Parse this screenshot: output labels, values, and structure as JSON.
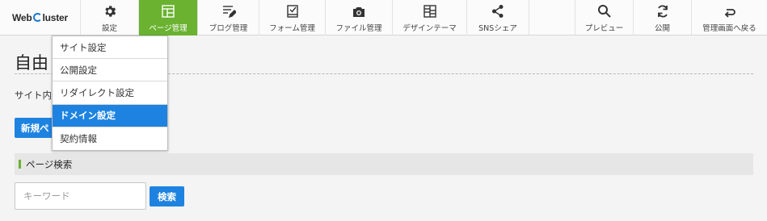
{
  "logo": {
    "text_before": "Web",
    "text_after": "luster"
  },
  "toolbar": {
    "items": [
      {
        "label": "設定",
        "icon": "gear-icon"
      },
      {
        "label": "ページ管理",
        "icon": "page-layout-icon"
      },
      {
        "label": "ブログ管理",
        "icon": "blog-edit-icon"
      },
      {
        "label": "フォーム管理",
        "icon": "form-check-icon"
      },
      {
        "label": "ファイル管理",
        "icon": "camera-icon"
      },
      {
        "label": "デザインテーマ",
        "icon": "design-layout-icon"
      },
      {
        "label": "SNSシェア",
        "icon": "share-icon"
      },
      {
        "label": "プレビュー",
        "icon": "search-icon"
      },
      {
        "label": "公開",
        "icon": "refresh-icon"
      },
      {
        "label": "管理画面へ戻る",
        "icon": "return-arrow-icon"
      }
    ],
    "active_label": "ページ管理"
  },
  "colors": {
    "accent_green": "#6ab230",
    "primary_blue": "#1e83e0"
  },
  "dropdown": {
    "items": [
      "サイト設定",
      "公開設定",
      "リダイレクト設定",
      "ドメイン設定",
      "契約情報"
    ],
    "selected": "ドメイン設定"
  },
  "main": {
    "title": "自由",
    "intro": "サイト内",
    "new_button": "新規ペ",
    "search_section_title": "ページ検索",
    "keyword_placeholder": "キーワード",
    "search_button": "検索"
  }
}
